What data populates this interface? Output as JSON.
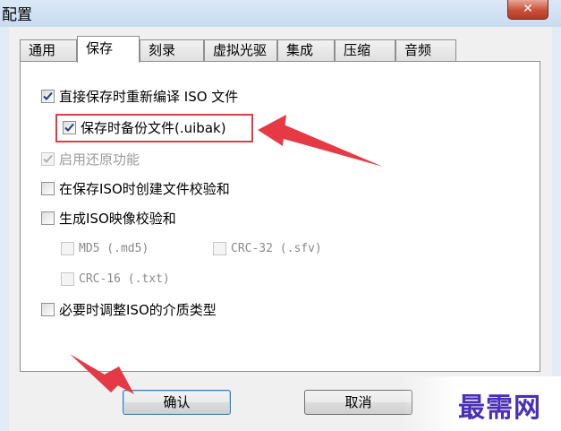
{
  "window": {
    "title": "配置",
    "close_glyph": "✕"
  },
  "tabs": [
    {
      "label": "通用",
      "active": false
    },
    {
      "label": "保存",
      "active": true
    },
    {
      "label": "刻录",
      "active": false
    },
    {
      "label": "虚拟光驱",
      "active": false
    },
    {
      "label": "集成",
      "active": false
    },
    {
      "label": "压缩",
      "active": false
    },
    {
      "label": "音频",
      "active": false
    }
  ],
  "options": {
    "recompile_iso": {
      "label": "直接保存时重新编译 ISO 文件",
      "checked": true
    },
    "backup_on_save": {
      "label": "保存时备份文件(.uibak)",
      "checked": true
    },
    "enable_restore": {
      "label": "启用还原功能",
      "checked": true,
      "disabled": true
    },
    "create_checksum": {
      "label": "在保存ISO时创建文件校验和",
      "checked": false
    },
    "generate_image_checksum": {
      "label": "生成ISO映像校验和",
      "checked": false
    },
    "md5": {
      "label": "MD5 (.md5)",
      "checked": false,
      "disabled": true
    },
    "crc32": {
      "label": "CRC-32 (.sfv)",
      "checked": false,
      "disabled": true
    },
    "crc16": {
      "label": "CRC-16 (.txt)",
      "checked": false,
      "disabled": true
    },
    "adjust_media_type": {
      "label": "必要时调整ISO的介质类型",
      "checked": false
    }
  },
  "buttons": {
    "ok_label": "确认",
    "cancel_label": "取消"
  },
  "watermark": {
    "text": "最需网"
  },
  "colors": {
    "annotation_red": "#e63946",
    "watermark": "#4a2fb8"
  }
}
